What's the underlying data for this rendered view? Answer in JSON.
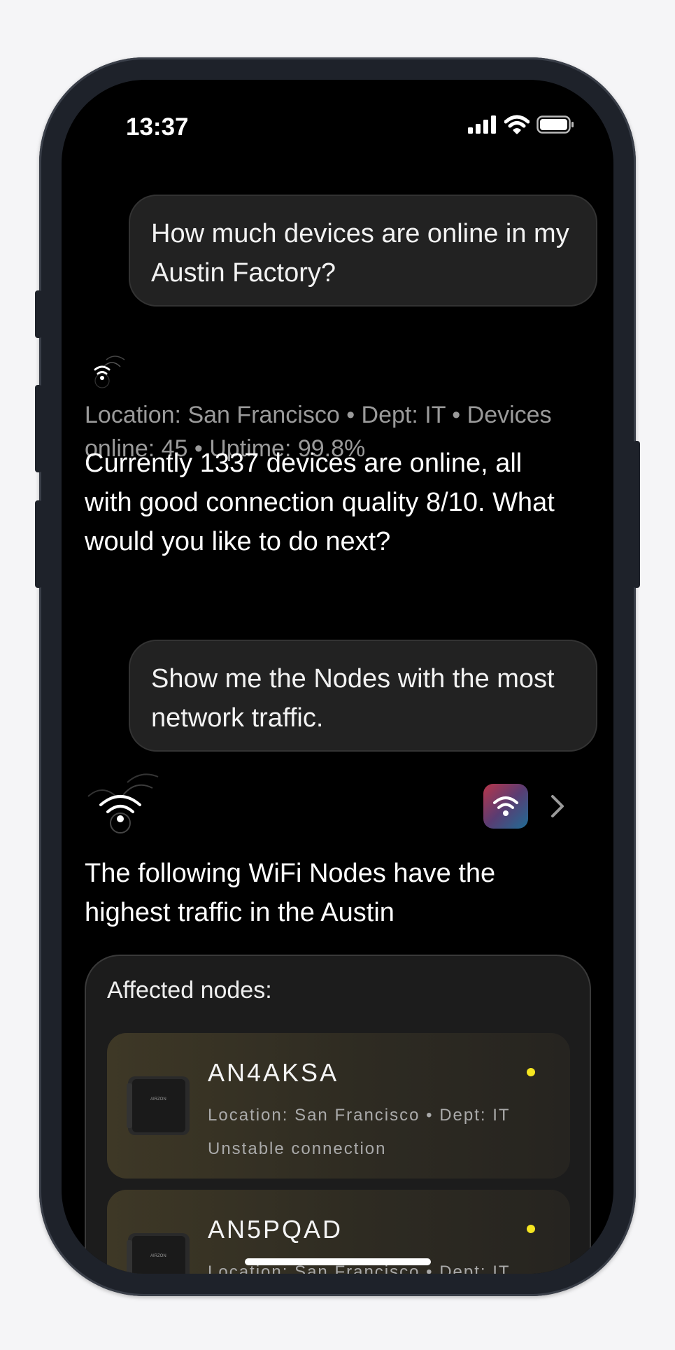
{
  "status_bar": {
    "time": "13:37"
  },
  "chat": {
    "user_message_1": "How much devices are online in my Austin Factory?",
    "assistant_1": {
      "meta": "Location: San Francisco • Dept: IT • Devices online: 45 • Uptime: 99.8%",
      "text": "Currently 1337 devices are online, all with good connection quality 8/10. What would you like to do next?"
    },
    "user_message_2": "Show me the Nodes with the most network traffic.",
    "assistant_2": {
      "text": "The following WiFi Nodes have the highest traffic in the Austin"
    }
  },
  "affected_card": {
    "title": "Affected nodes:",
    "nodes": [
      {
        "name": "AN4AKSA",
        "meta": "Location: San Francisco • Dept: IT",
        "status": "Unstable connection",
        "status_color": "#f5e520"
      },
      {
        "name": "AN5PQAD",
        "meta": "Location: San Francisco • Dept: IT",
        "status": "",
        "status_color": "#f5e520"
      }
    ]
  },
  "icons": [
    "signal-bars-icon",
    "wifi-icon",
    "battery-icon",
    "assistant-wifi-icon",
    "wifi-app-icon",
    "chevron-right-icon",
    "router-device-image"
  ]
}
